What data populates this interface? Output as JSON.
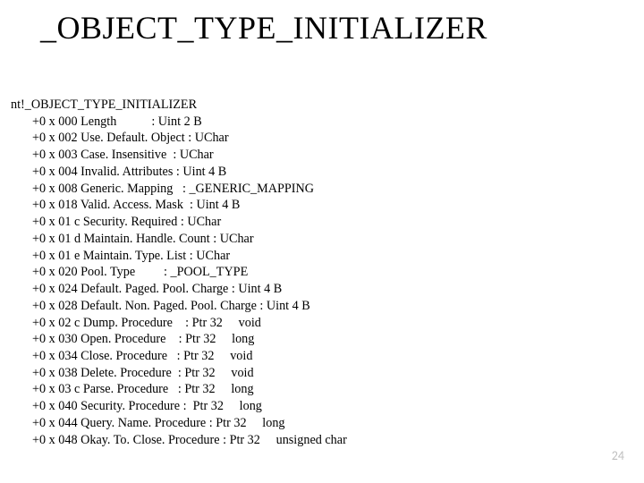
{
  "heading": "_OBJECT_TYPE_INITIALIZER",
  "struct_name": "nt!_OBJECT_TYPE_INITIALIZER",
  "fields": [
    "+0 x 000 Length           : Uint 2 B",
    "+0 x 002 Use. Default. Object : UChar",
    "+0 x 003 Case. Insensitive  : UChar",
    "+0 x 004 Invalid. Attributes : Uint 4 B",
    "+0 x 008 Generic. Mapping   : _GENERIC_MAPPING",
    "+0 x 018 Valid. Access. Mask  : Uint 4 B",
    "+0 x 01 c Security. Required : UChar",
    "+0 x 01 d Maintain. Handle. Count : UChar",
    "+0 x 01 e Maintain. Type. List : UChar",
    "+0 x 020 Pool. Type         : _POOL_TYPE",
    "+0 x 024 Default. Paged. Pool. Charge : Uint 4 B",
    "+0 x 028 Default. Non. Paged. Pool. Charge : Uint 4 B",
    "+0 x 02 c Dump. Procedure    : Ptr 32     void",
    "+0 x 030 Open. Procedure    : Ptr 32     long",
    "+0 x 034 Close. Procedure   : Ptr 32     void",
    "+0 x 038 Delete. Procedure  : Ptr 32     void",
    "+0 x 03 c Parse. Procedure   : Ptr 32     long",
    "+0 x 040 Security. Procedure :  Ptr 32     long",
    "+0 x 044 Query. Name. Procedure : Ptr 32     long",
    "+0 x 048 Okay. To. Close. Procedure : Ptr 32     unsigned char"
  ],
  "slide_number": "24"
}
